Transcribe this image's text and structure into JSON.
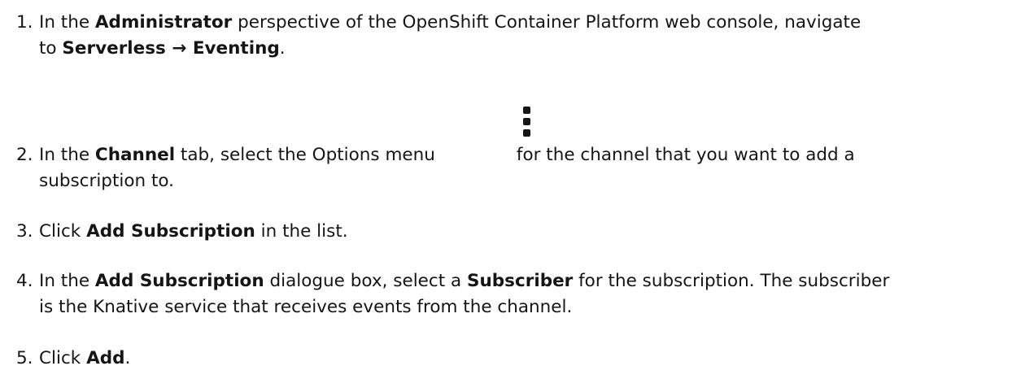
{
  "steps": [
    {
      "number": "1.",
      "parts": [
        "In the ",
        "Administrator",
        " perspective of the OpenShift Container Platform web console, navigate",
        "to ",
        "Serverless",
        " → ",
        "Eventing",
        "."
      ]
    },
    {
      "number": "2.",
      "parts": [
        "In the ",
        "Channel",
        " tab, select the Options menu",
        "for the channel that you want to add a",
        "subscription to."
      ],
      "icon": "kebab-menu-icon"
    },
    {
      "number": "3.",
      "parts": [
        "Click ",
        "Add Subscription",
        " in the list."
      ]
    },
    {
      "number": "4.",
      "parts": [
        "In the ",
        "Add Subscription",
        " dialogue box, select a ",
        "Subscriber",
        " for the subscription. The subscriber",
        "is the Knative service that receives events from the channel."
      ]
    },
    {
      "number": "5.",
      "parts": [
        "Click ",
        "Add",
        "."
      ]
    }
  ]
}
